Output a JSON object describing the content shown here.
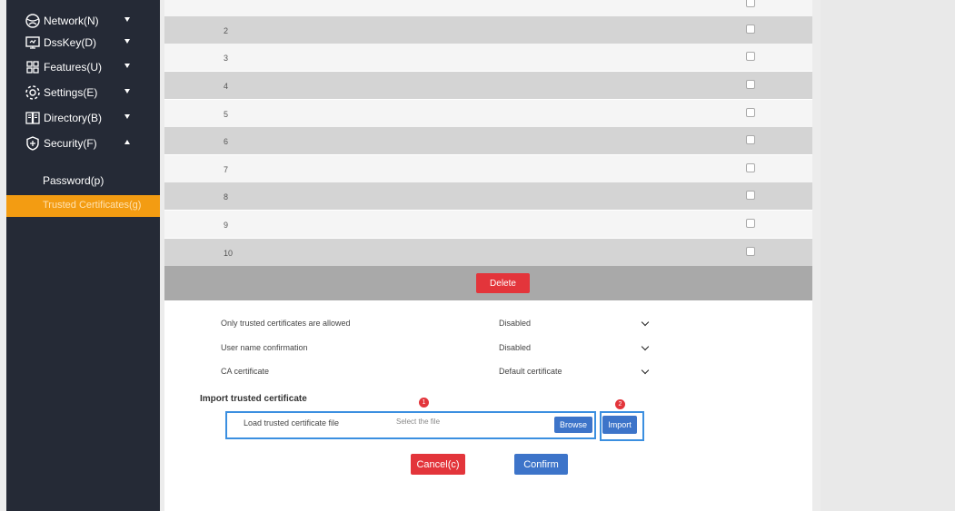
{
  "sidebar": {
    "items": [
      {
        "label": "Network(N)",
        "icon": "network-icon",
        "state": "collapsed"
      },
      {
        "label": "DssKey(D)",
        "icon": "monitor-icon",
        "state": "collapsed"
      },
      {
        "label": "Features(U)",
        "icon": "grid-icon",
        "state": "collapsed"
      },
      {
        "label": "Settings(E)",
        "icon": "gear-icon",
        "state": "collapsed"
      },
      {
        "label": "Directory(B)",
        "icon": "book-icon",
        "state": "collapsed"
      },
      {
        "label": "Security(F)",
        "icon": "shield-icon",
        "state": "expanded"
      }
    ],
    "sub_items": [
      {
        "label": "Password(p)",
        "active": false
      },
      {
        "label": "Trusted Certificates(g)",
        "active": true
      }
    ]
  },
  "table": {
    "rows": [
      {
        "num": "2",
        "checked": false
      },
      {
        "num": "3",
        "checked": false
      },
      {
        "num": "4",
        "checked": false
      },
      {
        "num": "5",
        "checked": false
      },
      {
        "num": "6",
        "checked": false
      },
      {
        "num": "7",
        "checked": false
      },
      {
        "num": "8",
        "checked": false
      },
      {
        "num": "9",
        "checked": false
      },
      {
        "num": "10",
        "checked": false
      }
    ],
    "delete_label": "Delete"
  },
  "settings": [
    {
      "label": "Only trusted certificates are allowed",
      "value": "Disabled"
    },
    {
      "label": "User name confirmation",
      "value": "Disabled"
    },
    {
      "label": "CA certificate",
      "value": "Default certificate"
    }
  ],
  "import": {
    "title": "Import trusted certificate",
    "file_label": "Load trusted certificate file",
    "placeholder": "Select the file",
    "browse_label": "Browse",
    "import_label": "Import",
    "badge1": "1",
    "badge2": "2"
  },
  "actions": {
    "cancel_label": "Cancel(c)",
    "confirm_label": "Confirm"
  },
  "colors": {
    "sidebar_bg": "#252a36",
    "active_item": "#f39c12",
    "delete_red": "#e3353b",
    "blue": "#3d74c9",
    "highlight": "#3b8fe0"
  }
}
